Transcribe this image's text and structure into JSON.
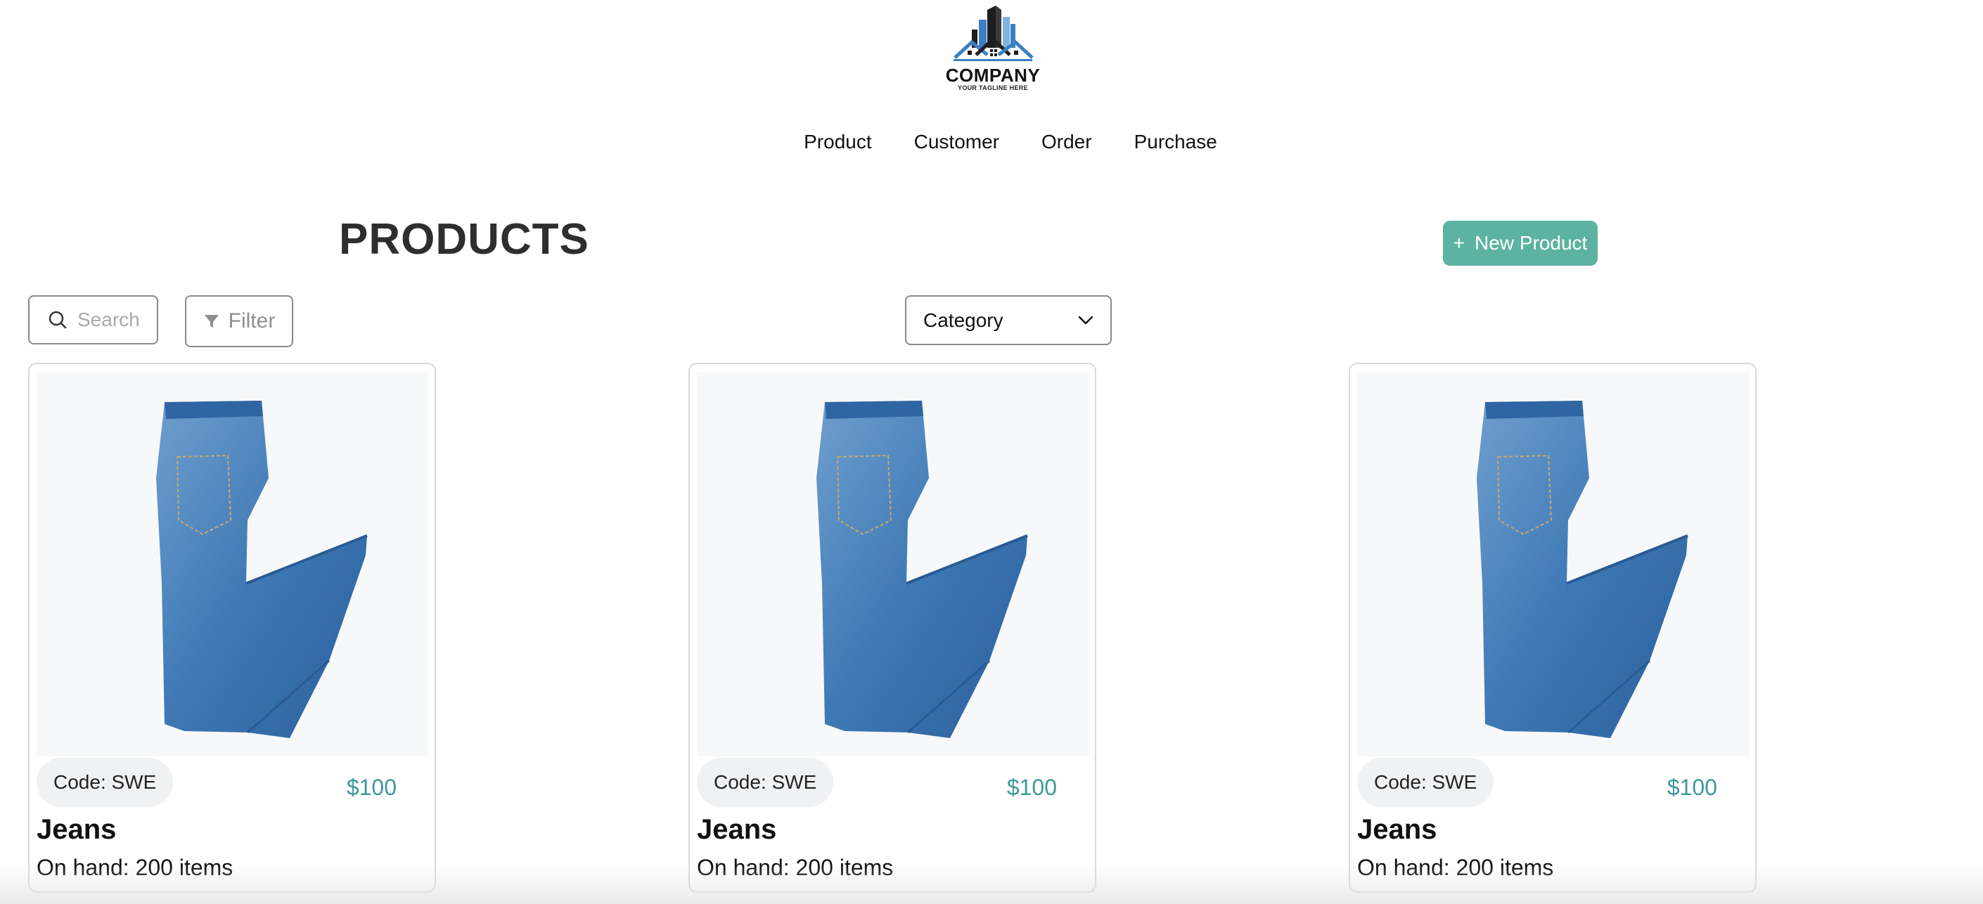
{
  "brand": {
    "name": "COMPANY",
    "tagline": "YOUR TAGLINE HERE",
    "colors": {
      "dark": "#1e1e1e",
      "blue": "#3b7fc4",
      "light_blue": "#7fb3e0"
    }
  },
  "nav": {
    "items": [
      {
        "label": "Product"
      },
      {
        "label": "Customer"
      },
      {
        "label": "Order"
      },
      {
        "label": "Purchase"
      }
    ]
  },
  "header": {
    "title": "PRODUCTS",
    "new_button_icon": "+",
    "new_button_label": "New Product",
    "accent_color": "#5db3a2"
  },
  "toolbar": {
    "search_placeholder": "Search",
    "search_value": "",
    "search_icon": "search-icon",
    "filter_label": "Filter",
    "filter_icon": "funnel-icon",
    "category_label": "Category",
    "category_icon": "chevron-down-icon"
  },
  "products": [
    {
      "code_label": "Code: SWE",
      "price": "$100",
      "name": "Jeans",
      "on_hand": "On hand: 200 items"
    },
    {
      "code_label": "Code: SWE",
      "price": "$100",
      "name": "Jeans",
      "on_hand": "On hand: 200 items"
    },
    {
      "code_label": "Code: SWE",
      "price": "$100",
      "name": "Jeans",
      "on_hand": "On hand: 200 items"
    }
  ],
  "price_color": "#3d999a"
}
